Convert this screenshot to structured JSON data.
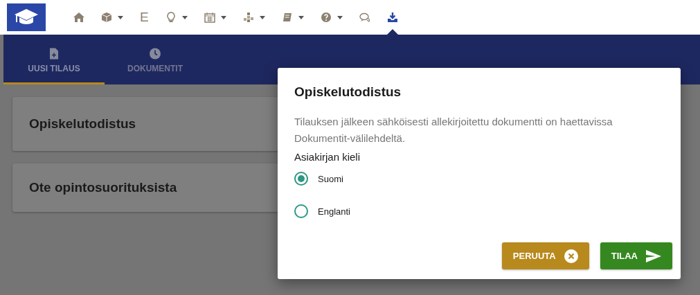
{
  "nav": [
    {
      "kind": "icon",
      "dropdown": false,
      "selected": false
    },
    {
      "kind": "icon",
      "dropdown": true,
      "selected": false
    },
    {
      "kind": "letter",
      "label": "E",
      "dropdown": false,
      "selected": false
    },
    {
      "kind": "icon",
      "dropdown": true,
      "selected": false
    },
    {
      "kind": "icon",
      "dropdown": true,
      "selected": false
    },
    {
      "kind": "icon",
      "dropdown": true,
      "selected": false
    },
    {
      "kind": "icon",
      "dropdown": true,
      "selected": false
    },
    {
      "kind": "icon",
      "dropdown": true,
      "selected": false
    },
    {
      "kind": "icon",
      "dropdown": false,
      "selected": false
    },
    {
      "kind": "icon",
      "dropdown": false,
      "selected": true
    }
  ],
  "tabs": [
    {
      "label": "UUSI TILAUS",
      "selected": true
    },
    {
      "label": "DOKUMENTIT",
      "selected": false
    }
  ],
  "cards": [
    "Opiskelutodistus",
    "Ote opintosuorituksista"
  ],
  "dialog": {
    "title": "Opiskelutodistus",
    "text": "Tilauksen jälkeen sähköisesti allekirjoitettu dokumentti on haettavissa Dokumentit-välilehdeltä.",
    "group_label": "Asiakirjan kieli",
    "options": [
      {
        "label": "Suomi",
        "selected": true
      },
      {
        "label": "Englanti",
        "selected": false
      }
    ],
    "buttons": [
      {
        "kind": "cancel",
        "label": "PERUUTA"
      },
      {
        "kind": "submit",
        "label": "TILAA"
      }
    ]
  }
}
